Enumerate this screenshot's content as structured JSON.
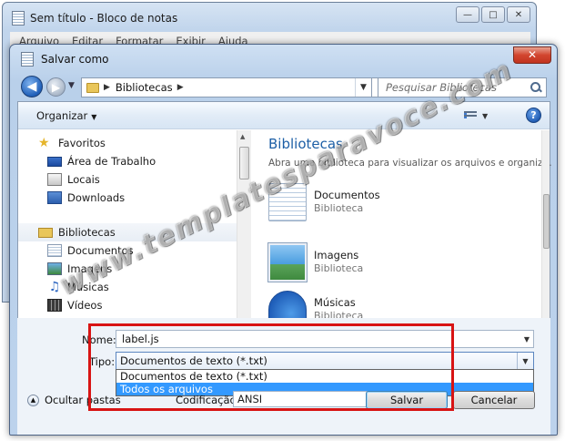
{
  "notepad": {
    "title": "Sem título - Bloco de notas",
    "menu": [
      "Arquivo",
      "Editar",
      "Formatar",
      "Exibir",
      "Ajuda"
    ],
    "controls": {
      "minimize": "—",
      "maximize": "□",
      "close": "✕"
    }
  },
  "dialog": {
    "title": "Salvar como",
    "close_glyph": "✕",
    "address": {
      "location": "Bibliotecas",
      "separator": "▶"
    },
    "search": {
      "placeholder": "Pesquisar Bibliotecas"
    },
    "toolbar": {
      "organize": "Organizar",
      "help_glyph": "?"
    },
    "nav": {
      "favorites": "Favoritos",
      "desktop": "Área de Trabalho",
      "locais": "Locais",
      "downloads": "Downloads",
      "libraries": "Bibliotecas",
      "documents": "Documentos",
      "images": "Imagens",
      "music": "Músicas",
      "videos": "Vídeos"
    },
    "content": {
      "title": "Bibliotecas",
      "subtitle": "Abra uma biblioteca para visualizar os arquivos e organiz...",
      "libraries": [
        {
          "name": "Documentos",
          "type": "Biblioteca",
          "icon": "documents-library-icon"
        },
        {
          "name": "Imagens",
          "type": "Biblioteca",
          "icon": "images-library-icon"
        },
        {
          "name": "Músicas",
          "type": "Biblioteca",
          "icon": "music-library-icon"
        }
      ]
    },
    "form": {
      "name_label": "Nome:",
      "name_value": "label.js",
      "type_label": "Tipo:",
      "type_value": "Documentos de texto (*.txt)",
      "type_options": [
        "Documentos de texto (*.txt)",
        "Todos os arquivos"
      ],
      "type_selected_index": 1,
      "encoding_label": "Codificação:",
      "encoding_value": "ANSI",
      "hide_folders": "Ocultar pastas",
      "save": "Salvar",
      "cancel": "Cancelar"
    }
  },
  "watermark": "www.templatesparavoce.com",
  "colors": {
    "highlight_box": "#d81414",
    "selection": "#3399ff",
    "link_title": "#1d5fa6"
  }
}
